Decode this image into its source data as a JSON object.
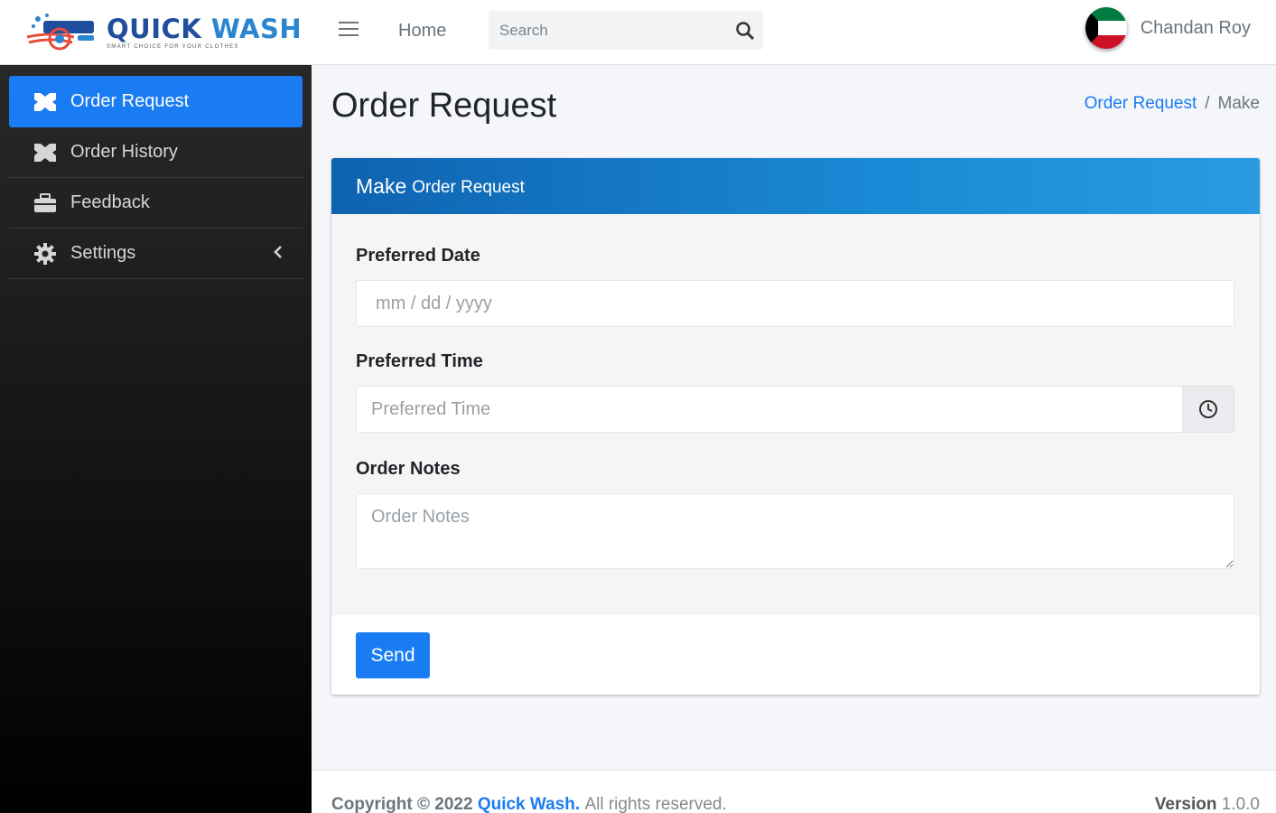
{
  "brand": {
    "name_part1": "QUICK",
    "name_part2": "WASH",
    "tagline": "SMART CHOICE FOR YOUR CLOTHES"
  },
  "sidebar": {
    "items": [
      {
        "label": "Order Request",
        "icon": "hanger-icon",
        "active": true
      },
      {
        "label": "Order History",
        "icon": "hanger-icon",
        "active": false
      },
      {
        "label": "Feedback",
        "icon": "briefcase-icon",
        "active": false
      },
      {
        "label": "Settings",
        "icon": "gear-icon",
        "active": false
      }
    ]
  },
  "topbar": {
    "home_label": "Home",
    "search_placeholder": "Search",
    "user_name": "Chandan Roy"
  },
  "page": {
    "title": "Order Request",
    "breadcrumb": {
      "link": "Order Request",
      "separator": "/",
      "current": "Make"
    }
  },
  "card": {
    "header_part1": "Make",
    "header_part2": "Order Request",
    "date_label": "Preferred Date",
    "date_placeholder": "mm / dd / yyyy",
    "time_label": "Preferred Time",
    "time_placeholder": "Preferred Time",
    "notes_label": "Order Notes",
    "notes_placeholder": "Order Notes",
    "send_label": "Send"
  },
  "footer": {
    "copyright_prefix": "Copyright © 2022",
    "brand_link": "Quick Wash.",
    "rights": "All rights reserved.",
    "version_label": "Version",
    "version_number": "1.0.0"
  },
  "colors": {
    "accent": "#1a7cf2",
    "header_gradient_start": "#0e63b0",
    "sidebar_bg": "#1c1c1c"
  }
}
